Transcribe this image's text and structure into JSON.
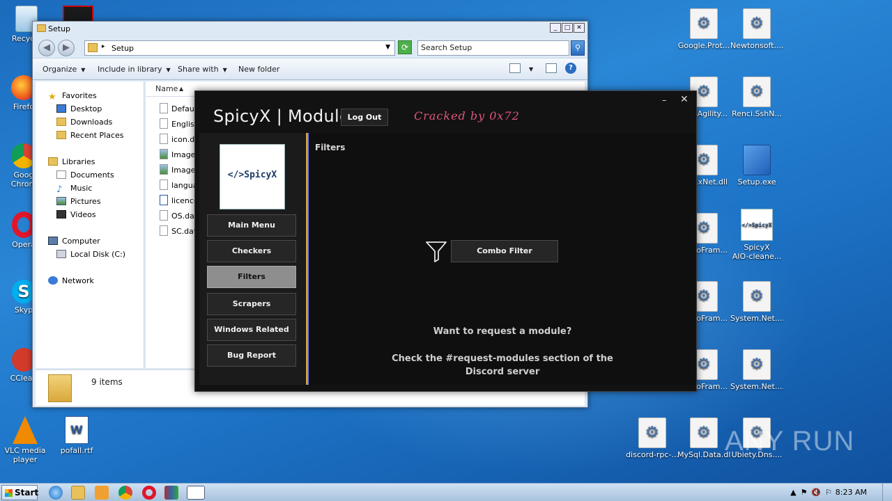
{
  "desktop": {
    "left_icons": [
      {
        "label": "Recycle",
        "icon": "recycle-bin-icon"
      },
      {
        "label": "Firefo",
        "icon": "firefox-icon"
      },
      {
        "label": "Goog\nChrom",
        "icon": "chrome-icon"
      },
      {
        "label": "Opera",
        "icon": "opera-icon"
      },
      {
        "label": "Skyp",
        "icon": "skype-icon"
      },
      {
        "label": "CClean",
        "icon": "ccleaner-icon"
      },
      {
        "label": "VLC media\nplayer",
        "icon": "vlc-icon"
      },
      {
        "label": "pofall.rtf",
        "icon": "word-doc-icon"
      }
    ],
    "right_icons": [
      {
        "label": "Google.Prot...",
        "icon": "dll-gear-icon"
      },
      {
        "label": "Newtonsoft....",
        "icon": "dll-gear-icon"
      },
      {
        "label": "Agility...",
        "icon": "dll-gear-icon"
      },
      {
        "label": "Renci.SshN...",
        "icon": "dll-gear-icon"
      },
      {
        "label": "f.xNet.dll",
        "icon": "dll-gear-icon"
      },
      {
        "label": "Setup.exe",
        "icon": "installer-icon"
      },
      {
        "label": "roFram...",
        "icon": "dll-gear-icon"
      },
      {
        "label": "SpicyX\nAIO-cleane...",
        "icon": "spicyx-icon"
      },
      {
        "label": "roFram...",
        "icon": "dll-gear-icon"
      },
      {
        "label": "System.Net....",
        "icon": "dll-gear-icon"
      },
      {
        "label": "roFram...",
        "icon": "dll-gear-icon"
      },
      {
        "label": "System.Net....",
        "icon": "dll-gear-icon"
      },
      {
        "label": "discord-rpc-...",
        "icon": "dll-gear-icon"
      },
      {
        "label": "MySql.Data.dll",
        "icon": "dll-gear-icon"
      },
      {
        "label": "Ubiety.Dns....",
        "icon": "dll-gear-icon"
      }
    ]
  },
  "explorer": {
    "title": "Setup",
    "address": "Setup",
    "search_placeholder": "Search Setup",
    "toolbar": {
      "organize": "Organize",
      "include": "Include in library",
      "share": "Share with",
      "new_folder": "New folder"
    },
    "nav": {
      "favorites": "Favorites",
      "desktop": "Desktop",
      "downloads": "Downloads",
      "recent": "Recent Places",
      "libraries": "Libraries",
      "documents": "Documents",
      "music": "Music",
      "pictures": "Pictures",
      "videos": "Videos",
      "computer": "Computer",
      "local_disk": "Local Disk (C:)",
      "network": "Network"
    },
    "col_name": "Name",
    "files": [
      "Default",
      "English",
      "icon.da",
      "Image_",
      "Image_",
      "langua",
      "licence",
      "OS.dat",
      "SC.dat"
    ],
    "status": "9 items"
  },
  "spicyx": {
    "title": "SpicyX | Modules",
    "logout": "Log Out",
    "cracked": "Cracked by 0x72",
    "logo_text": "</>SpicyX",
    "menu": {
      "main": "Main Menu",
      "checkers": "Checkers",
      "filters": "Filters",
      "scrapers": "Scrapers",
      "windows": "Windows Related",
      "bug": "Bug Report"
    },
    "section_title": "Filters",
    "combo_filter": "Combo Filter",
    "request_q": "Want to request a module?",
    "request_info": "Check the #request-modules section of the Discord server"
  },
  "taskbar": {
    "start": "Start",
    "clock": "8:23 AM"
  },
  "watermark": "ANY RUN"
}
